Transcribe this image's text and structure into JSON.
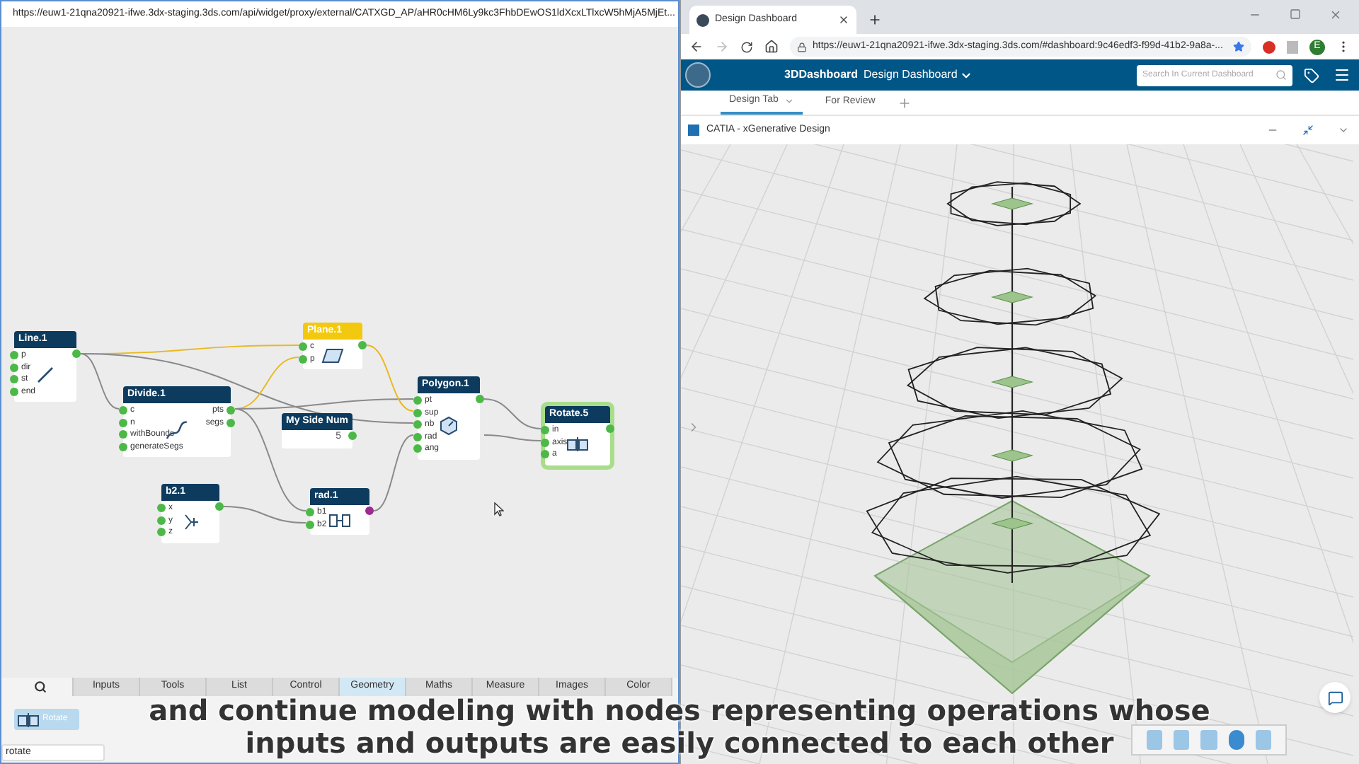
{
  "left_window": {
    "url": "https://euw1-21qna20921-ifwe.3dx-staging.3ds.com/api/widget/proxy/external/CATXGD_AP/aHR0cHM6Ly9kc3FhbDEwOS1ldXcxLTlxcW5hMjA5MjEt...",
    "graph": {
      "nodes": [
        {
          "title": "Line.1",
          "color": "#0d3b5e",
          "selected": false,
          "inputs": [
            "p",
            "dir",
            "st",
            "end"
          ],
          "outputs": [
            {
              "color": "#4cb848"
            }
          ]
        },
        {
          "title": "Plane.1",
          "color": "#f2c90f",
          "selected": false,
          "inputs": [
            "c",
            "p"
          ],
          "outputs": [
            {
              "color": "#4cb848"
            }
          ]
        },
        {
          "title": "Divide.1",
          "color": "#0d3b5e",
          "selected": false,
          "inputs": [
            "c",
            "n",
            "withBounds",
            "generateSegs"
          ],
          "outputs": [
            {
              "label": "pts",
              "color": "#4cb848"
            },
            {
              "label": "segs",
              "color": "#4cb848"
            }
          ]
        },
        {
          "title": "My Side Num",
          "color": "#0d3b5e",
          "selected": false,
          "value": "5",
          "outputs": [
            {
              "color": "#4cb848"
            }
          ]
        },
        {
          "title": "Polygon.1",
          "color": "#0d3b5e",
          "selected": false,
          "inputs": [
            "pt",
            "sup",
            "nb",
            "rad",
            "ang"
          ],
          "outputs": [
            {
              "color": "#4cb848"
            }
          ]
        },
        {
          "title": "Rotate.5",
          "color": "#0d3b5e",
          "selected": true,
          "inputs": [
            "in",
            "axis",
            "a"
          ],
          "outputs": [
            {
              "color": "#4cb848"
            }
          ]
        },
        {
          "title": "b2.1",
          "color": "#0d3b5e",
          "selected": false,
          "inputs": [
            "x",
            "y",
            "z"
          ],
          "outputs": [
            {
              "color": "#4cb848"
            }
          ]
        },
        {
          "title": "rad.1",
          "color": "#0d3b5e",
          "selected": false,
          "inputs": [
            "b1",
            "b2"
          ],
          "outputs": [
            {
              "color": "#9b2a91"
            }
          ]
        }
      ]
    },
    "palette": {
      "tabs": [
        {
          "kind": "search",
          "selected": false
        },
        {
          "kind": "text",
          "label": "Inputs",
          "selected": false
        },
        {
          "kind": "text",
          "label": "Tools",
          "selected": false
        },
        {
          "kind": "text",
          "label": "List",
          "selected": false
        },
        {
          "kind": "text",
          "label": "Control",
          "selected": false
        },
        {
          "kind": "text",
          "label": "Geometry",
          "selected": true
        },
        {
          "kind": "text",
          "label": "Maths",
          "selected": false
        },
        {
          "kind": "text",
          "label": "Measure",
          "selected": false
        },
        {
          "kind": "text",
          "label": "Images",
          "selected": false
        },
        {
          "kind": "text",
          "label": "Color",
          "selected": false
        }
      ],
      "result": "Rotate",
      "search_value": "rotate"
    }
  },
  "right_window": {
    "tab_title": "Design Dashboard",
    "url": "https://euw1-21qna20921-ifwe.3dx-staging.3ds.com/#dashboard:9c46edf3-f99d-41b2-9a8a-...",
    "avatar": "E",
    "brand": "3DDashboard",
    "dashboard": "Design Dashboard",
    "search": {
      "placeholder": "Search In Current Dashboard"
    },
    "tabs": [
      {
        "label": "Design Tab",
        "selected": true
      },
      {
        "label": "For Review",
        "selected": false
      }
    ],
    "widget_title": "CATIA - xGenerative Design"
  },
  "caption": [
    "and continue modeling with nodes representing operations whose",
    "inputs and outputs are easily connected to each other"
  ]
}
